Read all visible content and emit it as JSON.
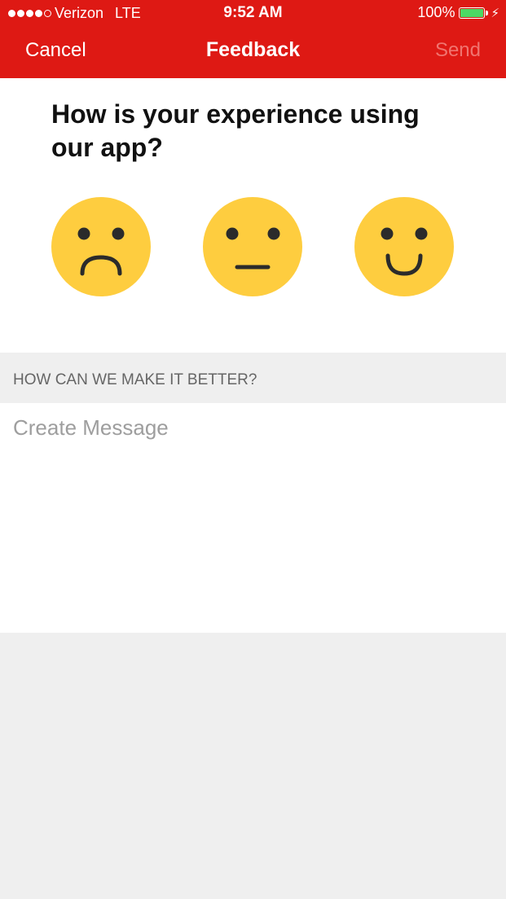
{
  "status_bar": {
    "carrier": "Verizon",
    "network": "LTE",
    "time": "9:52 AM",
    "battery_text": "100%",
    "battery_level": 1.0,
    "signal_bars": 4,
    "signal_total": 5,
    "charging_icon": "bolt-icon"
  },
  "nav": {
    "cancel_label": "Cancel",
    "title": "Feedback",
    "send_label": "Send"
  },
  "rating": {
    "question": "How is your experience using our app?",
    "options": [
      {
        "name": "sad",
        "icon": "sad-face-icon"
      },
      {
        "name": "neutral",
        "icon": "neutral-face-icon"
      },
      {
        "name": "happy",
        "icon": "happy-face-icon"
      }
    ]
  },
  "feedback": {
    "section_header": "HOW CAN WE MAKE IT BETTER?",
    "placeholder": "Create Message",
    "value": ""
  },
  "colors": {
    "nav_background": "#de1914",
    "send_disabled": "#f0746f",
    "face_fill": "#fecd3f",
    "face_features": "#2b2b2b",
    "battery_fill": "#4cd964",
    "section_background": "#efefef"
  }
}
